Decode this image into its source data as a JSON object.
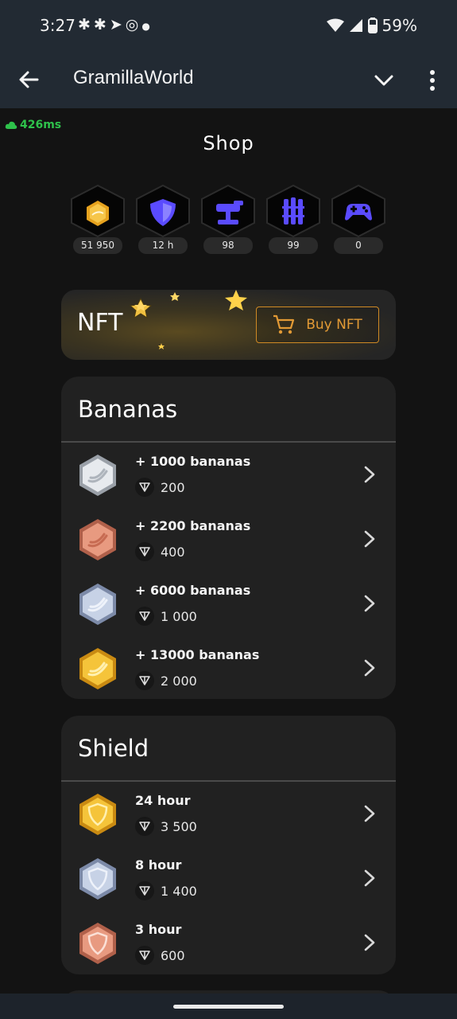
{
  "status": {
    "time": "3:27",
    "battery": "59%"
  },
  "appbar": {
    "title": "GramillaWorld"
  },
  "ping": "426ms",
  "page_title": "Shop",
  "stats": [
    {
      "icon": "coin-icon",
      "count": "51 950"
    },
    {
      "icon": "shield-icon",
      "count": "12 h"
    },
    {
      "icon": "turret-icon",
      "count": "98"
    },
    {
      "icon": "fence-icon",
      "count": "99"
    },
    {
      "icon": "gamepad-icon",
      "count": "0"
    }
  ],
  "nft": {
    "label": "NFT",
    "button": "Buy NFT"
  },
  "bananas": {
    "title": "Bananas",
    "items": [
      {
        "name": "+ 1000 bananas",
        "price": "200",
        "tier": "silver"
      },
      {
        "name": "+ 2200 bananas",
        "price": "400",
        "tier": "bronze"
      },
      {
        "name": "+ 6000 bananas",
        "price": "1 000",
        "tier": "blue-silver"
      },
      {
        "name": "+ 13000 bananas",
        "price": "2 000",
        "tier": "gold"
      }
    ]
  },
  "shield": {
    "title": "Shield",
    "items": [
      {
        "name": "24 hour",
        "price": "3 500",
        "tier": "gold"
      },
      {
        "name": "8 hour",
        "price": "1 400",
        "tier": "silver"
      },
      {
        "name": "3 hour",
        "price": "600",
        "tier": "bronze"
      }
    ]
  },
  "colors": {
    "accent": "#e29a35",
    "ping": "#2ec14b",
    "stat_icon": "#5a4bff"
  }
}
